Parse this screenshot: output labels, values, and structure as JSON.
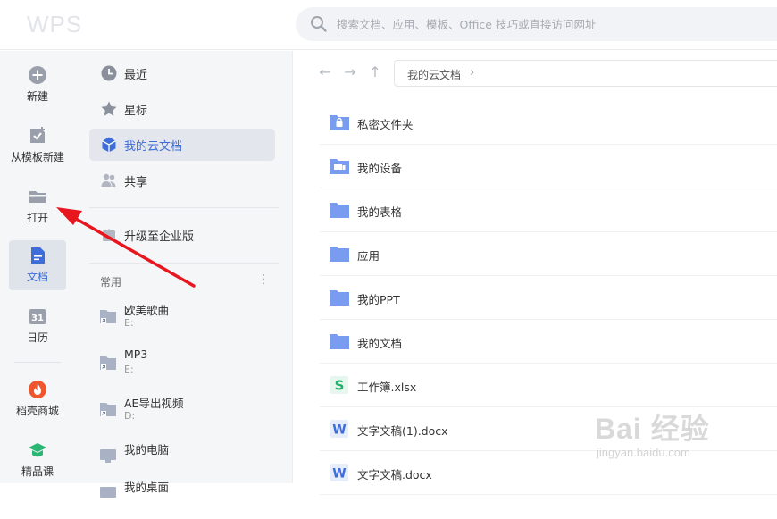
{
  "app": {
    "logo": "WPS"
  },
  "search": {
    "placeholder": "搜索文档、应用、模板、Office 技巧或直接访问网址"
  },
  "leftbar": {
    "items": [
      {
        "label": "新建",
        "icon": "plus-circle-icon"
      },
      {
        "label": "从模板新建",
        "icon": "template-icon"
      },
      {
        "label": "打开",
        "icon": "folder-icon"
      },
      {
        "label": "文档",
        "icon": "document-icon"
      },
      {
        "label": "日历",
        "icon": "calendar-icon"
      },
      {
        "label": "稻壳商城",
        "icon": "docer-store-icon"
      },
      {
        "label": "精品课",
        "icon": "course-icon"
      }
    ],
    "active": "文档",
    "accent": "#3e6dd9"
  },
  "nav": {
    "items": [
      {
        "label": "最近",
        "icon": "clock-icon"
      },
      {
        "label": "星标",
        "icon": "star-icon"
      },
      {
        "label": "我的云文档",
        "icon": "cloud-cube-icon"
      },
      {
        "label": "共享",
        "icon": "people-icon"
      },
      {
        "label": "升级至企业版",
        "icon": "upgrade-icon"
      }
    ],
    "active": "我的云文档",
    "section_title": "常用",
    "section_more": "⋮",
    "common": [
      {
        "name": "欧美歌曲",
        "path": "E:"
      },
      {
        "name": "MP3",
        "path": "E:"
      },
      {
        "name": "AE导出视频",
        "path": "D:"
      },
      {
        "name": "我的电脑",
        "path": ""
      },
      {
        "name": "我的桌面",
        "path": ""
      }
    ]
  },
  "main": {
    "back": "←",
    "forward": "→",
    "up": "↑",
    "breadcrumb": "我的云文档",
    "breadcrumb_chevron": "›",
    "files": [
      {
        "name": "私密文件夹",
        "type": "private-folder"
      },
      {
        "name": "我的设备",
        "type": "device-folder"
      },
      {
        "name": "我的表格",
        "type": "folder"
      },
      {
        "name": "应用",
        "type": "folder"
      },
      {
        "name": "我的PPT",
        "type": "folder"
      },
      {
        "name": "我的文档",
        "type": "folder"
      },
      {
        "name": "工作簿.xlsx",
        "type": "spreadsheet"
      },
      {
        "name": "文字文稿(1).docx",
        "type": "word"
      },
      {
        "name": "文字文稿.docx",
        "type": "word"
      }
    ]
  },
  "watermark": {
    "line1": "Bai 经验",
    "line2": "jingyan.baidu.com"
  },
  "annotation": {
    "color": "#e8161e"
  }
}
